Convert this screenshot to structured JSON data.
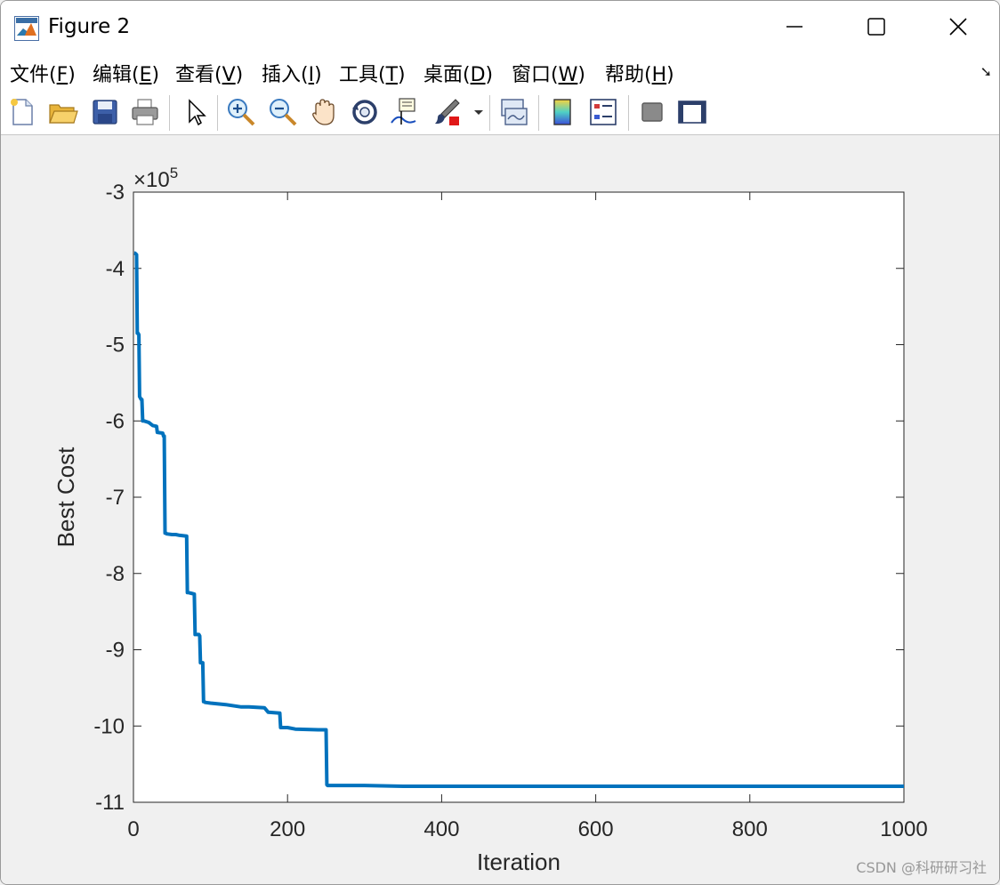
{
  "window": {
    "title": "Figure 2"
  },
  "menu": {
    "items": [
      {
        "label": "文件(",
        "key": "F",
        "close": ")"
      },
      {
        "label": "编辑(",
        "key": "E",
        "close": ")"
      },
      {
        "label": "查看(",
        "key": "V",
        "close": ")"
      },
      {
        "label": "插入(",
        "key": "I",
        "close": ")"
      },
      {
        "label": "工具(",
        "key": "T",
        "close": ")"
      },
      {
        "label": "桌面(",
        "key": "D",
        "close": ")"
      },
      {
        "label": "窗口(",
        "key": "W",
        "close": ")"
      },
      {
        "label": "帮助(",
        "key": "H",
        "close": ")"
      }
    ]
  },
  "toolbar": {
    "icons": [
      "new-figure-icon",
      "open-file-icon",
      "save-icon",
      "print-icon",
      "select-arrow-icon",
      "zoom-in-icon",
      "zoom-out-icon",
      "pan-hand-icon",
      "rotate-3d-icon",
      "data-cursor-icon",
      "brush-icon",
      "brush-dropdown-icon",
      "link-plot-icon",
      "colorbar-icon",
      "legend-icon",
      "hide-plot-tools-icon",
      "show-plot-tools-icon"
    ]
  },
  "watermark": "CSDN @科研研习社",
  "chart_data": {
    "type": "line",
    "xlabel": "Iteration",
    "ylabel": "Best Cost",
    "exponent_label": "×10",
    "exponent_power": "5",
    "xlim": [
      0,
      1000
    ],
    "ylim": [
      -11,
      -3
    ],
    "xticks": [
      0,
      200,
      400,
      600,
      800,
      1000
    ],
    "xtick_labels": [
      "0",
      "200",
      "400",
      "600",
      "800",
      "1000"
    ],
    "yticks": [
      -11,
      -10,
      -9,
      -8,
      -7,
      -6,
      -5,
      -4,
      -3
    ],
    "ytick_labels": [
      "-11",
      "-10",
      "-9",
      "-8",
      "-7",
      "-6",
      "-5",
      "-4",
      "-3"
    ],
    "line_color": "#0072BD",
    "grid": false,
    "series": [
      {
        "x": [
          1,
          2,
          4,
          5,
          6,
          7,
          8,
          9,
          10,
          11,
          12,
          13,
          14,
          20,
          25,
          30,
          31,
          38,
          39,
          40,
          41,
          42,
          43,
          50,
          55,
          60,
          69,
          70,
          71,
          75,
          79,
          80,
          85,
          86,
          87,
          90,
          91,
          92,
          93,
          100,
          120,
          140,
          150,
          170,
          175,
          190,
          191,
          200,
          210,
          240,
          250,
          251,
          252,
          300,
          350,
          400,
          600,
          800,
          1000
        ],
        "y": [
          -3.8,
          -3.8,
          -3.82,
          -4.85,
          -4.85,
          -4.87,
          -5.68,
          -5.7,
          -5.72,
          -5.72,
          -6.0,
          -6.0,
          -6.0,
          -6.02,
          -6.06,
          -6.07,
          -6.15,
          -6.16,
          -6.2,
          -6.2,
          -7.47,
          -7.47,
          -7.48,
          -7.49,
          -7.49,
          -7.5,
          -7.51,
          -8.25,
          -8.25,
          -8.26,
          -8.27,
          -8.8,
          -8.8,
          -8.82,
          -9.17,
          -9.17,
          -9.68,
          -9.68,
          -9.69,
          -9.7,
          -9.72,
          -9.75,
          -9.75,
          -9.76,
          -9.82,
          -9.83,
          -10.02,
          -10.02,
          -10.04,
          -10.05,
          -10.05,
          -10.77,
          -10.78,
          -10.78,
          -10.79,
          -10.79,
          -10.79,
          -10.79,
          -10.79
        ]
      }
    ]
  }
}
